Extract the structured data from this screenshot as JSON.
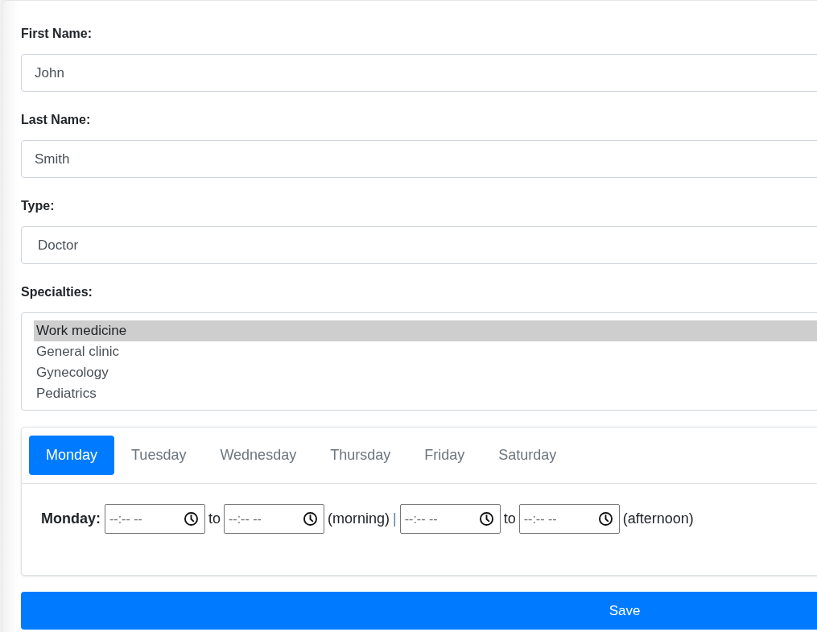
{
  "form": {
    "fields": [
      {
        "kind": "text",
        "label": "First Name:",
        "value": "John"
      },
      {
        "kind": "text",
        "label": "Last Name:",
        "value": "Smith"
      },
      {
        "kind": "select",
        "label": "Type:",
        "value": "Doctor"
      },
      {
        "kind": "listbox",
        "label": "Specialties:",
        "options": [
          {
            "label": "Work medicine",
            "selected": true
          },
          {
            "label": "General clinic",
            "selected": false
          },
          {
            "label": "Gynecology",
            "selected": false
          },
          {
            "label": "Pediatrics",
            "selected": false
          }
        ]
      }
    ]
  },
  "schedule": {
    "tabs": [
      {
        "label": "Monday",
        "selected": true
      },
      {
        "label": "Tuesday",
        "selected": false
      },
      {
        "label": "Wednesday",
        "selected": false
      },
      {
        "label": "Thursday",
        "selected": false
      },
      {
        "label": "Friday",
        "selected": false
      },
      {
        "label": "Saturday",
        "selected": false
      }
    ],
    "panel": {
      "day_label": "Monday:",
      "parts": [
        {
          "kind": "time",
          "placeholder": "--:-- --"
        },
        {
          "kind": "text",
          "text": "to"
        },
        {
          "kind": "time",
          "placeholder": "--:-- --"
        },
        {
          "kind": "text",
          "text": "(morning)"
        },
        {
          "kind": "separator",
          "text": "|"
        },
        {
          "kind": "time",
          "placeholder": "--:-- --"
        },
        {
          "kind": "text",
          "text": "to"
        },
        {
          "kind": "time",
          "placeholder": "--:-- --"
        },
        {
          "kind": "text",
          "text": "(afternoon)"
        }
      ]
    }
  },
  "save_button": "Save"
}
